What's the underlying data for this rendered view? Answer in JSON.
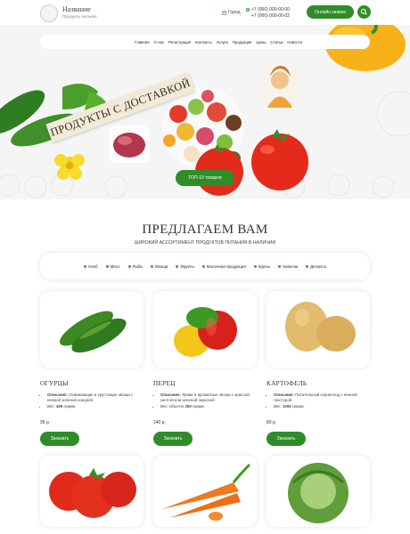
{
  "header": {
    "logo_title": "Название",
    "logo_sub": "Продукты питания",
    "city": "Город",
    "phone1": "+7 (000) 000-00-00",
    "phone2": "+7 (000) 000-00-02",
    "online_btn": "Онлайн заявка"
  },
  "nav": [
    "Главная",
    "О нас",
    "Регистрация",
    "Контакты",
    "Услуги",
    "Продукция",
    "Цены",
    "Статьи",
    "Новости"
  ],
  "hero": {
    "label": "ПРОДУКТЫ С ДОСТАВКОЙ",
    "button": "ТОП-10 товаров"
  },
  "section": {
    "title": "ПРЕДЛАГАЕМ ВАМ",
    "subtitle": "ШИРОКИЙ АССОРТИМЕНТ ПРОДУКТОВ ПИТАНИЯ В НАЛИЧИИ"
  },
  "categories": [
    "Хлеб",
    "Мясо",
    "Рыба",
    "Овощи",
    "Фрукты",
    "Молочная продукция",
    "Крупы",
    "Напитки",
    "Десерты"
  ],
  "products": [
    {
      "name": "ОГУРЦЫ",
      "desc_label": "Описание:",
      "desc": "Освежающие и хрустящие овощи с нежной зеленой кожурой.",
      "weight_label": "Вес:",
      "weight": "400",
      "weight_unit": "грамм.",
      "price": "95 р.",
      "btn": "Заказать"
    },
    {
      "name": "ПЕРЕЦ",
      "desc_label": "Описание:",
      "desc": "Яркие и ароматные овощи с красной, желтой или зеленой окраской",
      "weight_label": "Вес:",
      "weight_prefix": "Обычно",
      "weight": "250",
      "weight_unit": "грамм.",
      "price": "140 р.",
      "btn": "Заказать"
    },
    {
      "name": "КАРТОФЕЛЬ",
      "desc_label": "Описание:",
      "desc": "Питательный корнеплод с нежной текстурой",
      "weight_label": "Вес:",
      "weight": "1000",
      "weight_unit": "грамм.",
      "price": "80 р.",
      "btn": "Заказать"
    }
  ],
  "colors": {
    "accent": "#2f8d28",
    "hero_bg": "#f5f5f5"
  }
}
